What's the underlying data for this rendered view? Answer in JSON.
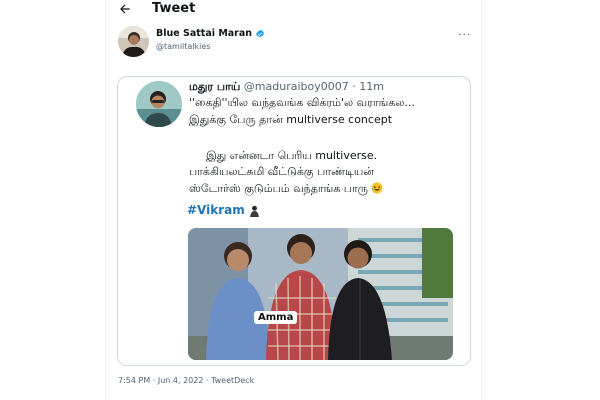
{
  "header": {
    "title": "Tweet"
  },
  "author": {
    "name": "Blue Sattai Maran",
    "handle": "@tamiltalkies",
    "more_label": "···"
  },
  "quoted_tweet": {
    "name": "மதுர பாய்",
    "handle": "@maduraiboy0007",
    "separator": " · ",
    "time": "11m",
    "line1": "''கைதி''யில வந்தவங்க விக்ரம்'ல வராங்கல...",
    "line2": "இதுக்கு பேரு தான் multiverse concept",
    "line3": "இது என்னடா பெரிய multiverse.",
    "line4": "பாக்கியலட்சுமி வீட்டுக்கு பாண்டியன்",
    "line5": "ஸ்டோர்ஸ் குடும்பம் வந்தாங்க பாரு",
    "hashtag": "#Vikram",
    "media": {
      "overlay_text": "Amma"
    }
  },
  "meta": {
    "text": "7:54 PM · Jun 4, 2022 · TweetDeck"
  },
  "colors": {
    "link": "#1d75b8",
    "muted": "#536471",
    "verified": "#1d9bf0"
  }
}
